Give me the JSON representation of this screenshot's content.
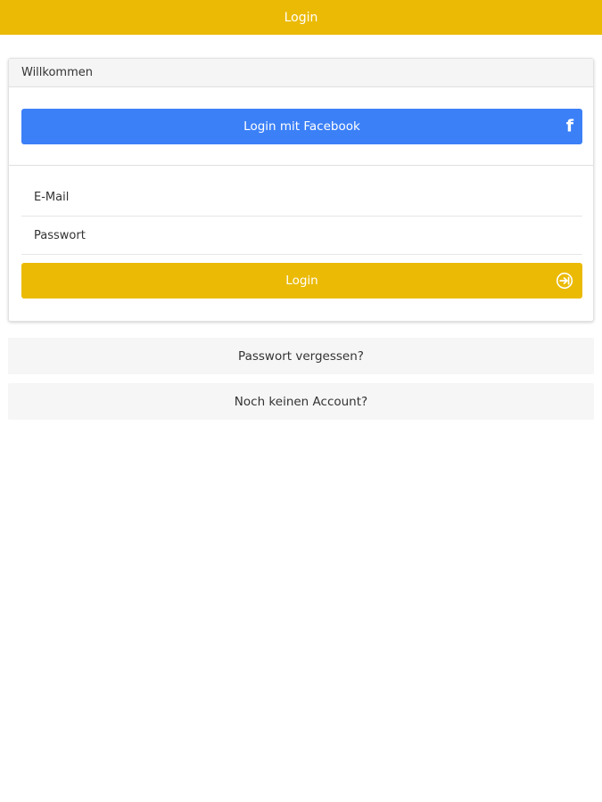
{
  "header": {
    "title": "Login"
  },
  "card": {
    "title": "Willkommen",
    "facebook_button": {
      "label": "Login mit Facebook",
      "icon": "facebook-icon"
    },
    "email_field": {
      "placeholder": "E-Mail",
      "value": ""
    },
    "password_field": {
      "placeholder": "Passwort",
      "value": ""
    },
    "login_button": {
      "label": "Login",
      "icon": "sign-in-icon"
    }
  },
  "links": {
    "forgot_password": "Passwort vergessen?",
    "no_account": "Noch keinen Account?"
  },
  "colors": {
    "brand_yellow": "#EBBA05",
    "facebook_blue": "#3B80F7",
    "link_background": "#f6f6f6"
  }
}
